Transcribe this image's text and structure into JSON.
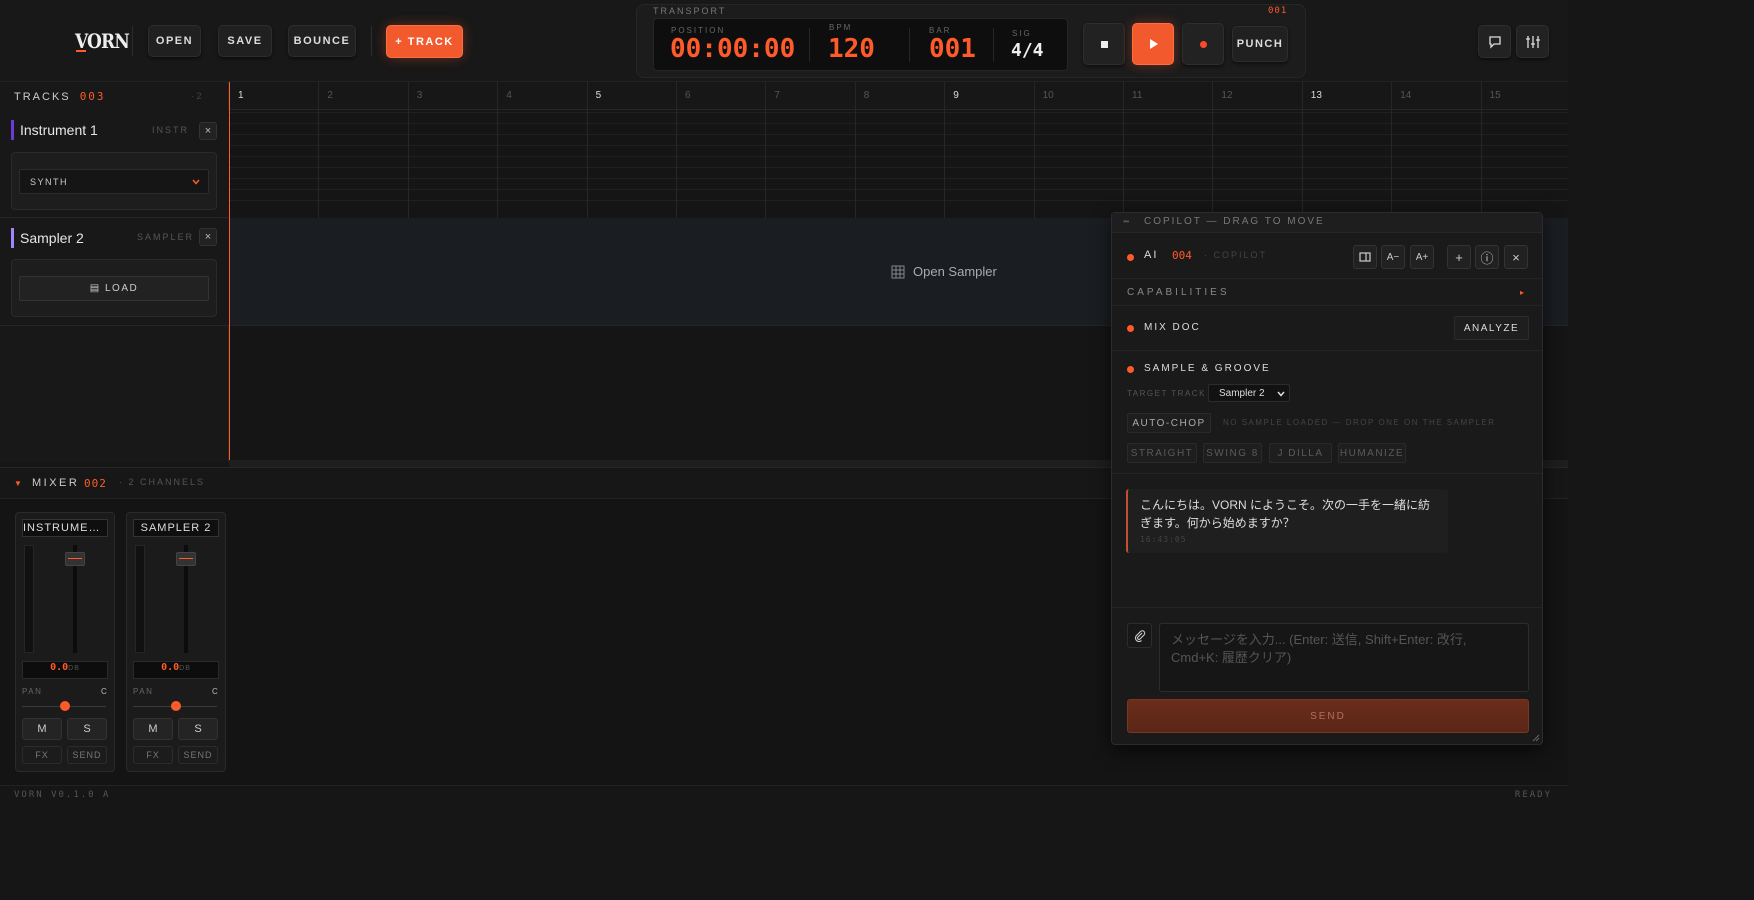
{
  "header": {
    "logo": "VORN",
    "open_label": "OPEN",
    "save_label": "SAVE",
    "bounce_label": "BOUNCE",
    "add_track_label": "+ TRACK"
  },
  "transport": {
    "label": "TRANSPORT",
    "counter": "001",
    "position_label": "POSITION",
    "position": "00:00:00",
    "bpm_label": "BPM",
    "bpm": "120",
    "bar_label": "BAR",
    "bar": "001",
    "sig_label": "SIG",
    "sig": "4/4",
    "punch_label": "PUNCH"
  },
  "tracks": {
    "title": "TRACKS",
    "count": "003",
    "extra": "· 2",
    "items": [
      {
        "name": "Instrument 1",
        "type": "INSTR",
        "accent": "#6a3bd6",
        "control": "SYNTH"
      },
      {
        "name": "Sampler 2",
        "type": "SAMPLER",
        "accent": "#a184ff",
        "control": "▤ LOAD"
      }
    ]
  },
  "timeline": {
    "bars": [
      "1",
      "2",
      "3",
      "4",
      "5",
      "6",
      "7",
      "8",
      "9",
      "10",
      "11",
      "12",
      "13",
      "14",
      "15"
    ],
    "open_sampler_label": "Open Sampler",
    "playhead_color": "#ff5a2a"
  },
  "mixer": {
    "title": "MIXER",
    "count": "002",
    "channels_label": "· 2 CHANNELS",
    "strips": [
      {
        "name": "INSTRUMENT…",
        "db": "0.0",
        "db_unit": "DB",
        "pan_label": "PAN",
        "pan_value": "C",
        "mute": "M",
        "solo": "S",
        "fx": "FX",
        "send": "SEND"
      },
      {
        "name": "SAMPLER 2",
        "db": "0.0",
        "db_unit": "DB",
        "pan_label": "PAN",
        "pan_value": "C",
        "mute": "M",
        "solo": "S",
        "fx": "FX",
        "send": "SEND"
      }
    ]
  },
  "copilot": {
    "title": "COPILOT — DRAG TO MOVE",
    "ai_label": "AI",
    "ai_count": "004",
    "ai_sub": "· COPILOT",
    "btn_dec": "A−",
    "btn_inc": "A+",
    "btn_add": "+",
    "btn_info": "ⓘ",
    "btn_close": "×",
    "capabilities_label": "CAPABILITIES",
    "mix_doc_label": "MIX DOC",
    "analyze_label": "ANALYZE",
    "sample_groove_label": "SAMPLE & GROOVE",
    "target_track_label": "TARGET TRACK",
    "target_track_value": "Sampler 2",
    "auto_chop_label": "AUTO-CHOP",
    "no_sample_text": "NO SAMPLE LOADED — DROP ONE ON THE SAMPLER",
    "grooves": [
      "STRAIGHT",
      "SWING 8",
      "J DILLA",
      "HUMANIZE"
    ],
    "message_text": "こんにちは。VORN にようこそ。次の一手を一緒に紡ぎます。何から始めますか？",
    "message_time": "16:43:05",
    "input_placeholder": "メッセージを入力... (Enter: 送信, Shift+Enter: 改行, Cmd+K: 履歴クリア)",
    "send_label": "SEND"
  },
  "status": {
    "version": "VORN V0.1.0 A",
    "state": "READY"
  },
  "colors": {
    "accent": "#ff5a2a",
    "background": "#161616"
  }
}
